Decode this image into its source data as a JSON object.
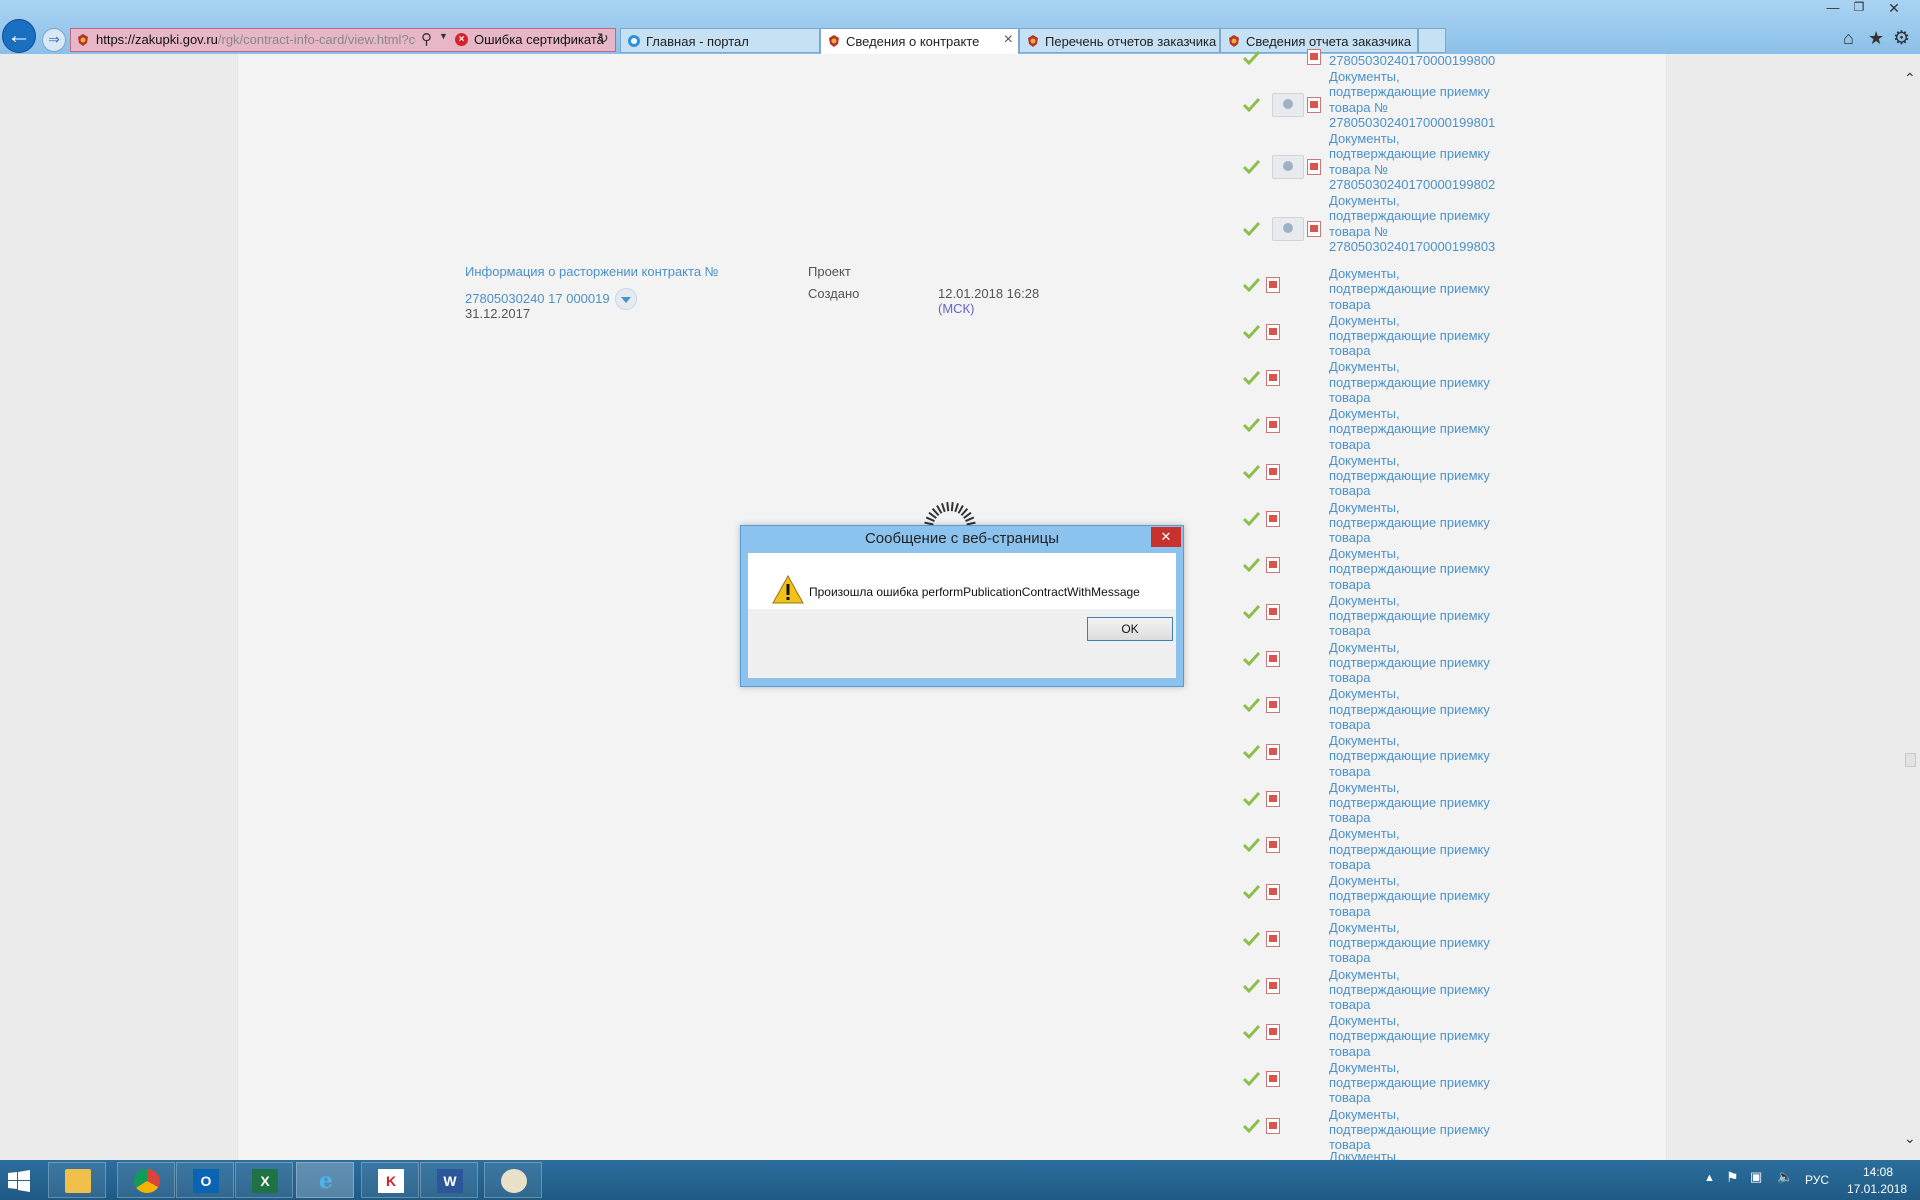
{
  "browser": {
    "url_domain": "https://zakupki.gov.ru",
    "url_path": "/rgk/contract-info-card/view.html?co",
    "cert_error": "Ошибка сертификата",
    "tabs": [
      {
        "label": "Главная - портал",
        "active": false
      },
      {
        "label": "Сведения о контракте",
        "active": true
      },
      {
        "label": "Перечень отчетов заказчика",
        "active": false
      },
      {
        "label": "Сведения отчета заказчика",
        "active": false
      }
    ]
  },
  "page": {
    "termination_label": "Информация о расторжении контракта №",
    "termination_number": "27805030240 17 000019",
    "termination_date": "31.12.2017",
    "status": "Проект",
    "created_label": "Создано",
    "created_value": "12.01.2018 16:28",
    "created_tz": "(МСК)",
    "doc_top_partial": "278050302401700001998​00",
    "signed_docs": [
      {
        "lines": [
          "Документы,",
          "подтверждающие приемку",
          "товара №",
          "278050302401700001998​01"
        ]
      },
      {
        "lines": [
          "Документы,",
          "подтверждающие приемку",
          "товара №",
          "278050302401700001998​02"
        ]
      },
      {
        "lines": [
          "Документы,",
          "подтверждающие приемку",
          "товара №",
          "278050302401700001998​03"
        ]
      }
    ],
    "doc_generic": [
      "Документы,",
      "подтверждающие приемку",
      "товара"
    ],
    "doc_tail_partial": "Документы,",
    "doc_generic_count": 19
  },
  "dialog": {
    "title": "Сообщение с веб-страницы",
    "message": "Произошла ошибка performPublicationContractWithMessage",
    "ok_label": "OK",
    "close_label": "✕"
  },
  "taskbar": {
    "lang": "РУС",
    "time": "14:08",
    "date": "17.01.2018",
    "apps": [
      "file-explorer",
      "chrome",
      "outlook",
      "excel",
      "internet-explorer",
      "kaspersky",
      "word",
      "paint"
    ]
  },
  "colors": {
    "link": "#4c91c9",
    "dialog_frame": "#8cc3ee",
    "dialog_close": "#c7322c",
    "address_error": "#e8b7c7",
    "taskbar": "#1f5a84"
  }
}
